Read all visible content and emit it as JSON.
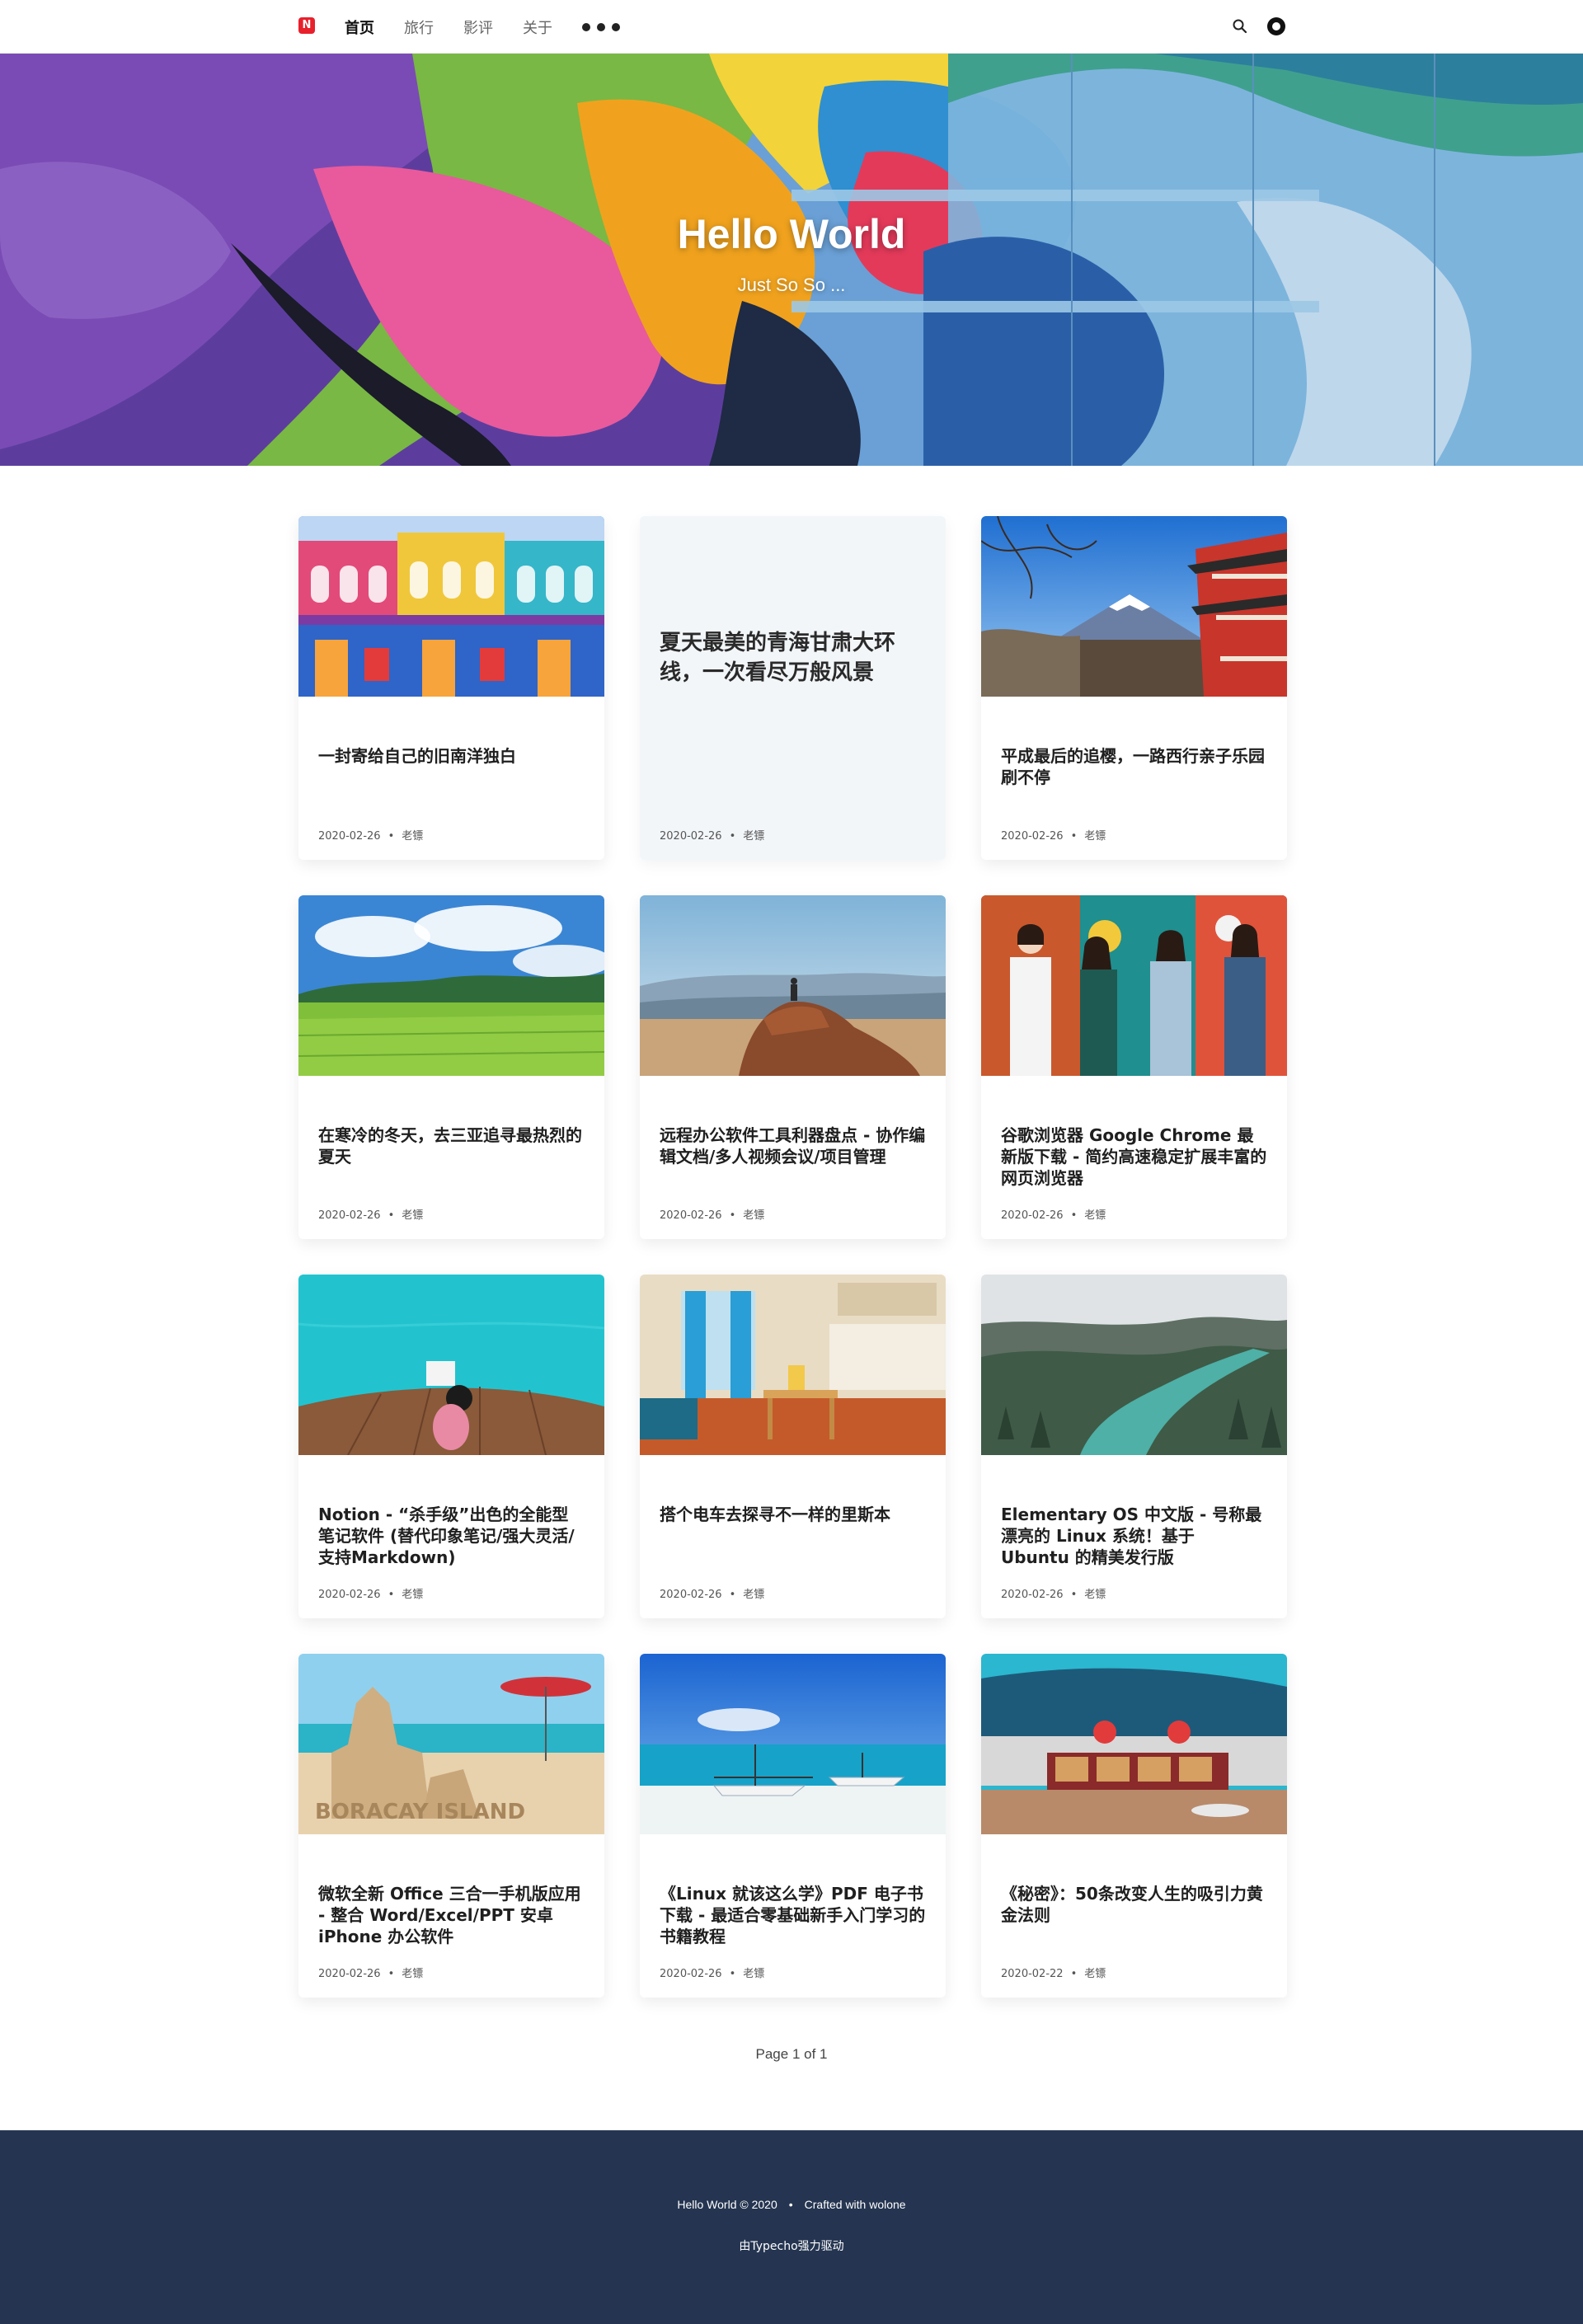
{
  "header": {
    "logo_letter": "N",
    "nav": [
      "首页",
      "旅行",
      "影评",
      "关于"
    ],
    "active_nav": "首页"
  },
  "hero": {
    "title": "Hello World",
    "subtitle": "Just So So ..."
  },
  "posts": [
    {
      "title": "一封寄给自己的旧南洋独白",
      "date": "2020-02-26",
      "author": "老镖",
      "image": "colorful-shophouse"
    },
    {
      "title": "夏天最美的青海甘肃大环线，一次看尽万般风景",
      "date": "2020-02-26",
      "author": "老镖",
      "image": null
    },
    {
      "title": "平成最后的追樱，一路西行亲子乐园刷不停",
      "date": "2020-02-26",
      "author": "老镖",
      "image": "mount-fuji-pagoda"
    },
    {
      "title": "在寒冷的冬天，去三亚追寻最热烈的夏天",
      "date": "2020-02-26",
      "author": "老镖",
      "image": "green-rice-field"
    },
    {
      "title": "远程办公软件工具利器盘点 - 协作编辑文档/多人视频会议/项目管理",
      "date": "2020-02-26",
      "author": "老镖",
      "image": "person-on-rock"
    },
    {
      "title": "谷歌浏览器 Google Chrome 最新版下载 - 简约高速稳定扩展丰富的网页浏览器",
      "date": "2020-02-26",
      "author": "老镖",
      "image": "friends-graffiti-wall"
    },
    {
      "title": "Notion - “杀手级”出色的全能型笔记软件 (替代印象笔记/强大灵活/支持Markdown)",
      "date": "2020-02-26",
      "author": "老镖",
      "image": "woman-on-pier"
    },
    {
      "title": "搭个电车去探寻不一样的里斯本",
      "date": "2020-02-26",
      "author": "老镖",
      "image": "cozy-apartment"
    },
    {
      "title": "Elementary OS 中文版 - 号称最漂亮的 Linux 系统！基于 Ubuntu 的精美发行版",
      "date": "2020-02-26",
      "author": "老镖",
      "image": "river-forest-fog"
    },
    {
      "title": "微软全新 Office 三合一手机版应用 - 整合 Word/Excel/PPT 安卓 iPhone 办公软件",
      "date": "2020-02-26",
      "author": "老镖",
      "image": "sandcastle-beach"
    },
    {
      "title": "《Linux 就该这么学》PDF 电子书下载 - 最适合零基础新手入门学习的书籍教程",
      "date": "2020-02-26",
      "author": "老镖",
      "image": "boats-tropical-beach"
    },
    {
      "title": "《秘密》：50条改变人生的吸引力黄金法则",
      "date": "2020-02-22",
      "author": "老镖",
      "image": "retro-diner"
    }
  ],
  "sandcastle_text": "BORACAY ISLAND",
  "pagination": "Page 1 of 1",
  "footer": {
    "copyright": "Hello World © 2020",
    "crafted": "Crafted with wolone",
    "powered": "由Typecho强力驱动"
  },
  "colors": {
    "brand_red": "#e8202c",
    "footer_bg": "#253551"
  }
}
